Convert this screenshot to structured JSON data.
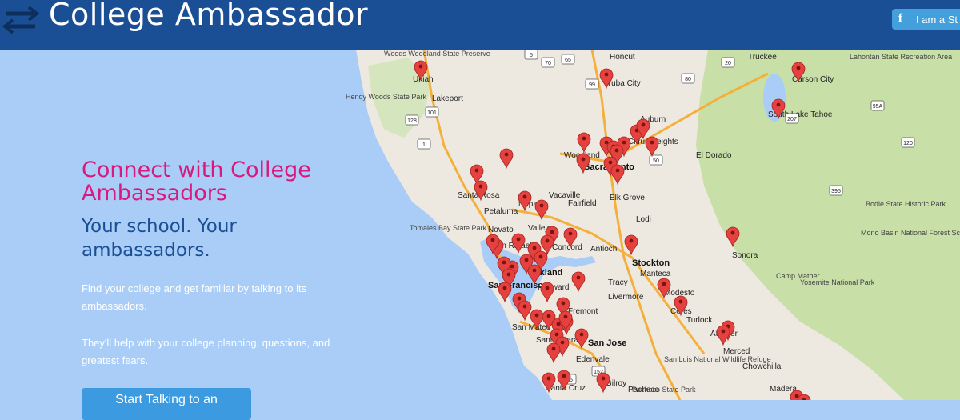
{
  "header": {
    "title": "College Ambassador",
    "role_button": {
      "icon": "facebook-icon",
      "label": "I am a St"
    }
  },
  "hero": {
    "headline": "Connect with College Ambassadors",
    "subheadline": "Your school. Your ambassadors.",
    "paragraph1": "Find your college and get familiar by talking to its ambassadors.",
    "paragraph2": "They'll help with your college planning, questions, and greatest fears.",
    "cta_label": "Start Talking to an"
  },
  "map": {
    "cities": [
      "Ukiah",
      "Yuba City",
      "Truckee",
      "Carson City",
      "Lakeport",
      "South Lake Tahoe",
      "Woodland",
      "Sacramento",
      "Citrus Heights",
      "Auburn",
      "El Dorado",
      "Santa Rosa",
      "Napa",
      "Vacaville",
      "Fairfield",
      "Elk Grove",
      "Petaluma",
      "Novato",
      "Vallejo",
      "San Rafael",
      "Concord",
      "Antioch",
      "Stockton",
      "Lodi",
      "Manteca",
      "Tracy",
      "Sonora",
      "San Francisco",
      "Oakland",
      "Hayward",
      "Livermore",
      "Modesto",
      "Ceres",
      "Turlock",
      "San Mateo",
      "Fremont",
      "Santa Clara",
      "San Jose",
      "Atwater",
      "Merced",
      "Chowchilla",
      "Edenvale",
      "Gilroy",
      "Santa Cruz",
      "Madera",
      "Honcut",
      "Pacheco"
    ],
    "labels": [
      "Woods Woodland State Preserve",
      "Hendy Woods State Park",
      "Lahontan State Recreation Area",
      "Tomales Bay State Park",
      "Bodie State Historic Park",
      "Mono Basin National Forest Scenic Area",
      "Camp Mather",
      "Yosemite National Park",
      "San Luis National Wildlife Refuge",
      "Pacheco State Park"
    ],
    "highways": [
      "5",
      "70",
      "99",
      "80",
      "65",
      "20",
      "101",
      "128",
      "1",
      "50",
      "395",
      "207",
      "95A",
      "120",
      "152",
      "25"
    ],
    "pin_color": "#e5423f",
    "water_color": "#a9cdf6",
    "land_color": "#ede9e0",
    "forest_color": "#c8dfa8"
  }
}
